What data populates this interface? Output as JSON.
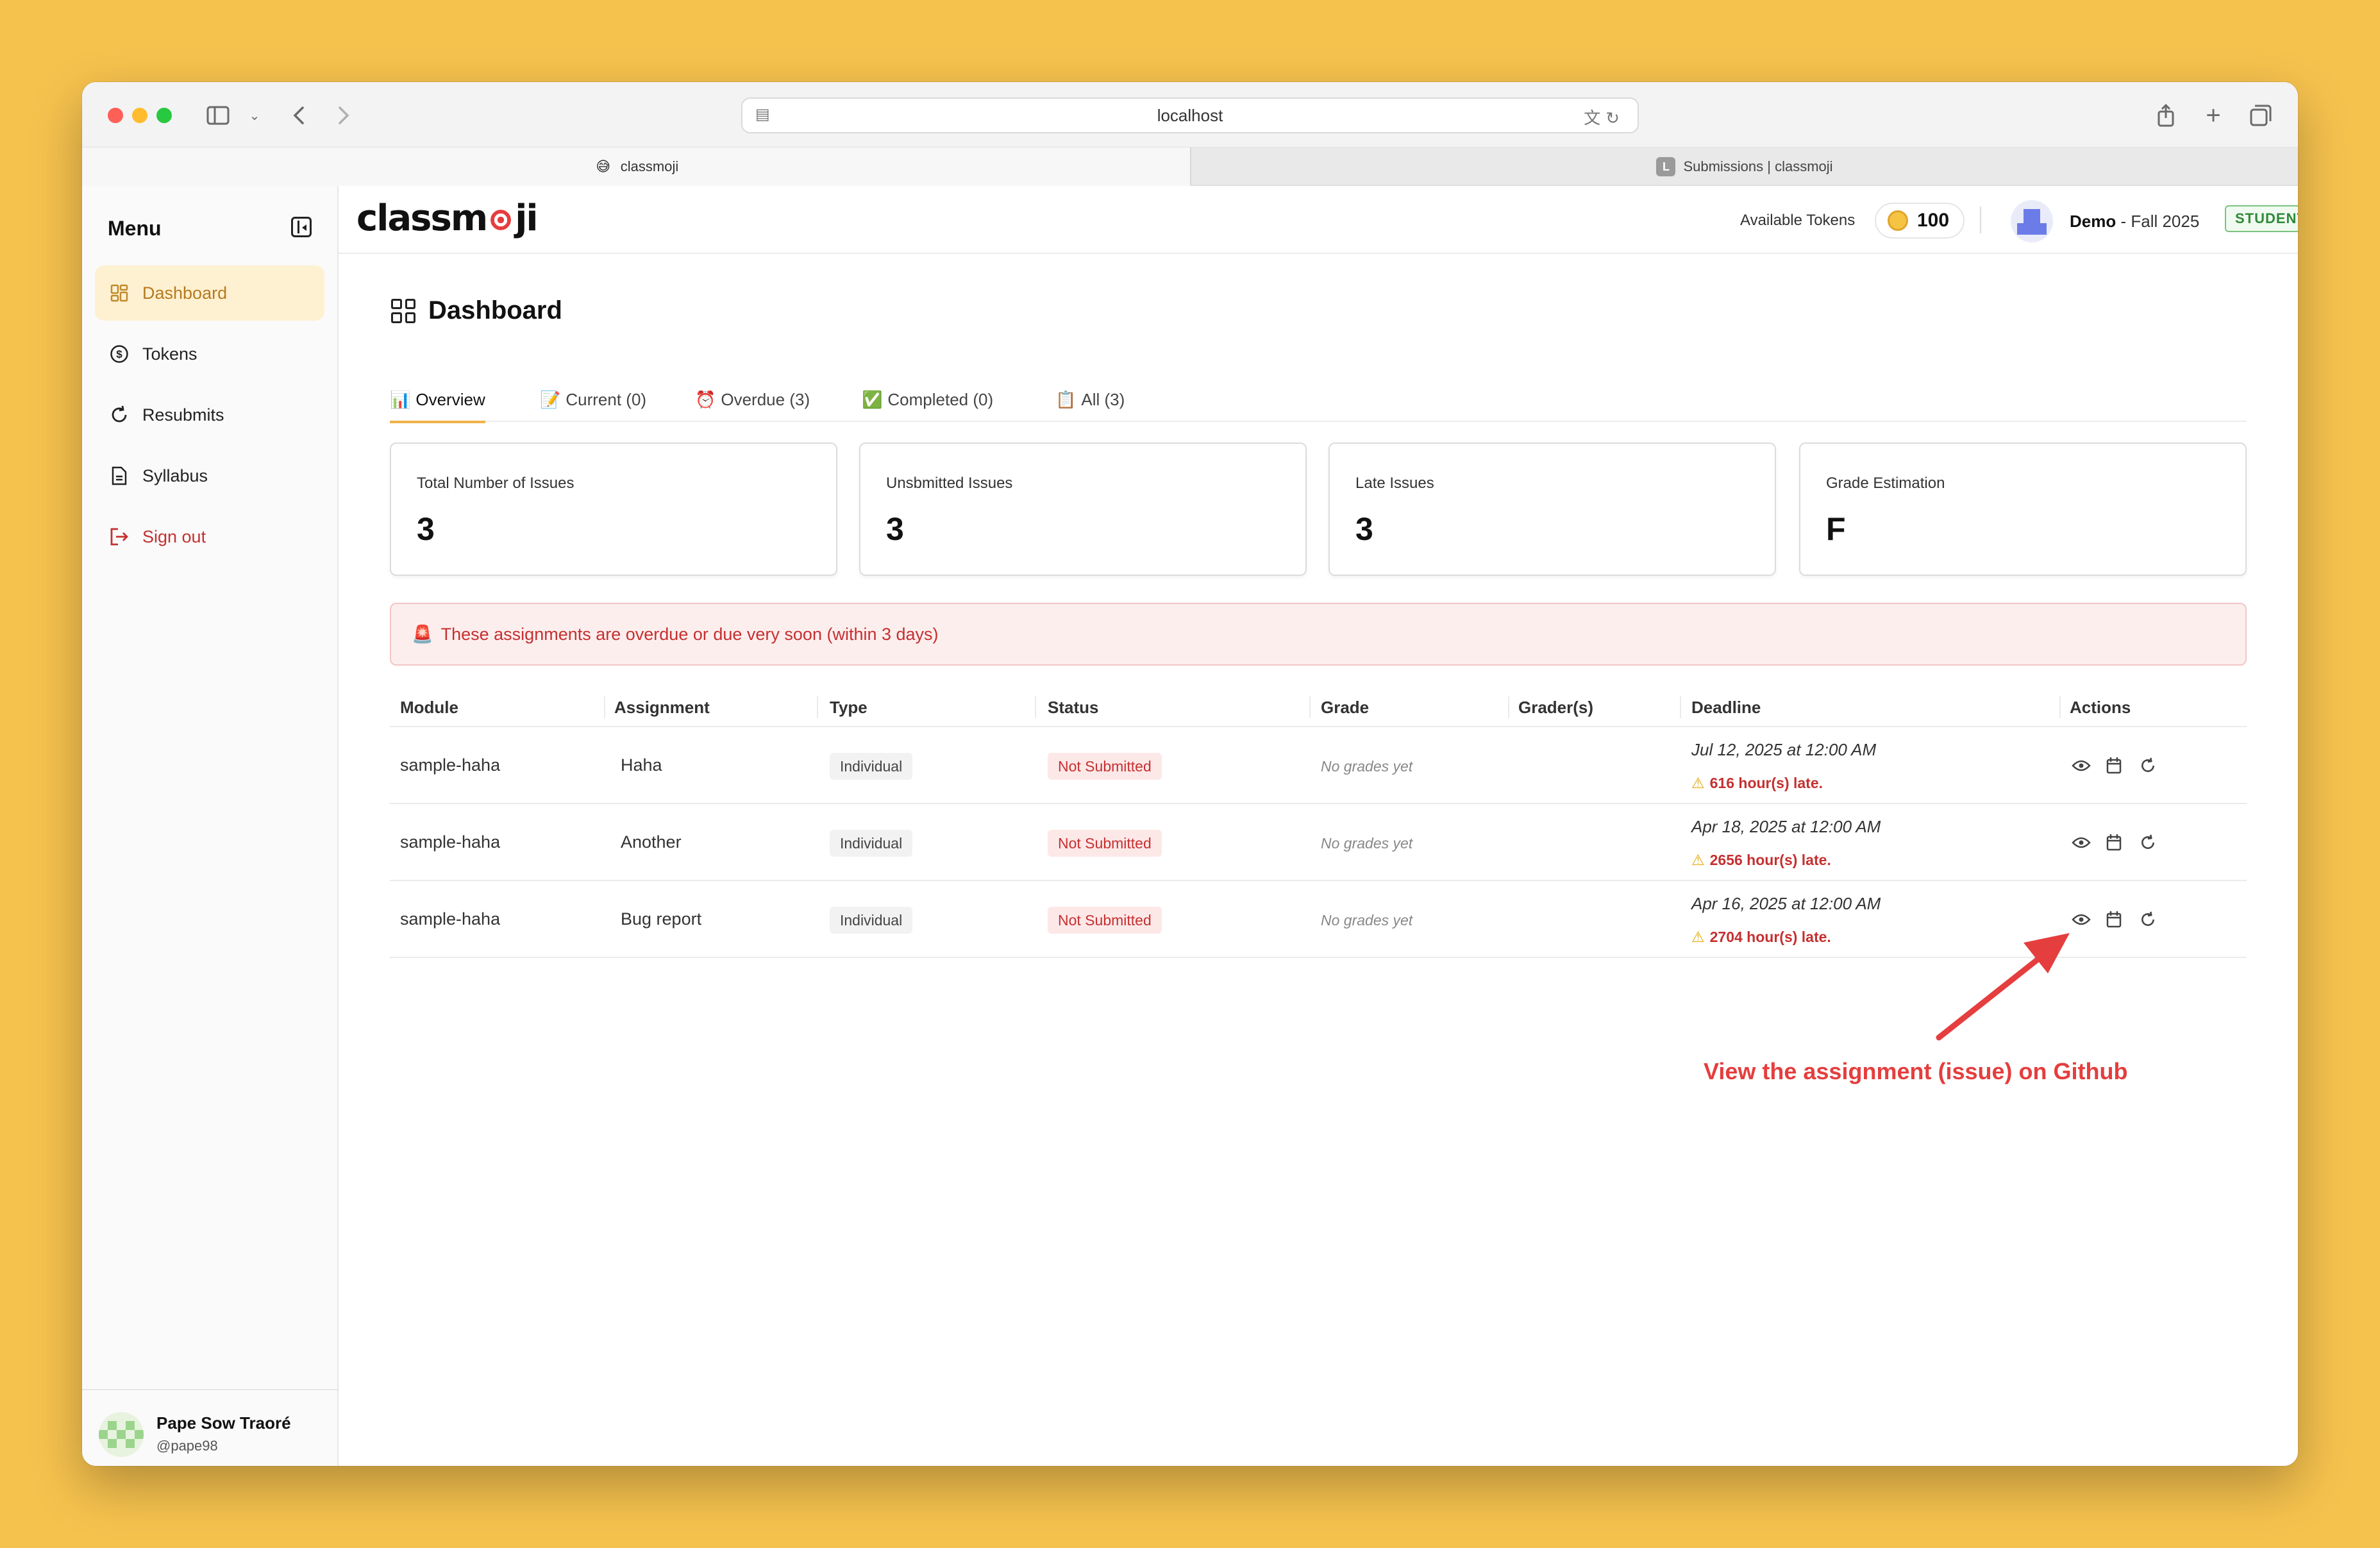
{
  "browser": {
    "url": "localhost",
    "tabs": [
      {
        "label": "classmoji",
        "favicon": "😅"
      },
      {
        "label": "Submissions | classmoji",
        "favicon": "L"
      }
    ]
  },
  "sidebar": {
    "title": "Menu",
    "items": [
      {
        "label": "Dashboard",
        "icon": "dashboard-icon",
        "active": true
      },
      {
        "label": "Tokens",
        "icon": "dollar-icon"
      },
      {
        "label": "Resubmits",
        "icon": "resubmit-icon"
      },
      {
        "label": "Syllabus",
        "icon": "document-icon"
      },
      {
        "label": "Sign out",
        "icon": "sign-out-icon"
      }
    ],
    "user": {
      "name": "Pape Sow Traoré",
      "handle": "@pape98"
    }
  },
  "header": {
    "logo": "classmoji",
    "tokens_label": "Available Tokens",
    "tokens_value": "100",
    "profile_name": "Demo",
    "profile_term": " - Fall 2025",
    "role": "STUDENT"
  },
  "page": {
    "title": "Dashboard",
    "tabs": [
      {
        "emoji": "📊",
        "label": "Overview"
      },
      {
        "emoji": "📝",
        "label": "Current (0)"
      },
      {
        "emoji": "⏰",
        "label": "Overdue (3)"
      },
      {
        "emoji": "✅",
        "label": "Completed (0)"
      },
      {
        "emoji": "📋",
        "label": "All (3)"
      }
    ],
    "stats": [
      {
        "label": "Total Number of Issues",
        "value": "3"
      },
      {
        "label": "Unsbmitted Issues",
        "value": "3"
      },
      {
        "label": "Late Issues",
        "value": "3"
      },
      {
        "label": "Grade Estimation",
        "value": "F"
      }
    ],
    "alert": {
      "emoji": "🚨",
      "text": "These assignments are overdue or due very soon (within 3 days)"
    }
  },
  "table": {
    "headers": [
      "Module",
      "Assignment",
      "Type",
      "Status",
      "Grade",
      "Grader(s)",
      "Deadline",
      "Actions"
    ],
    "rows": [
      {
        "module": "sample-haha",
        "assignment": "Haha",
        "type": "Individual",
        "status": "Not Submitted",
        "grade": "No grades yet",
        "deadline": "Jul 12, 2025 at 12:00 AM",
        "late": "616 hour(s) late."
      },
      {
        "module": "sample-haha",
        "assignment": "Another",
        "type": "Individual",
        "status": "Not Submitted",
        "grade": "No grades yet",
        "deadline": "Apr 18, 2025 at 12:00 AM",
        "late": "2656 hour(s) late."
      },
      {
        "module": "sample-haha",
        "assignment": "Bug report",
        "type": "Individual",
        "status": "Not Submitted",
        "grade": "No grades yet",
        "deadline": "Apr 16, 2025 at 12:00 AM",
        "late": "2704 hour(s) late."
      }
    ]
  },
  "annotation": {
    "text": "View the assignment (issue) on Github",
    "color": "#E53E3E"
  },
  "colors": {
    "background": "#F6C24E",
    "accent": "#B7791F",
    "danger": "#C53030",
    "success": "#2F8A38"
  }
}
